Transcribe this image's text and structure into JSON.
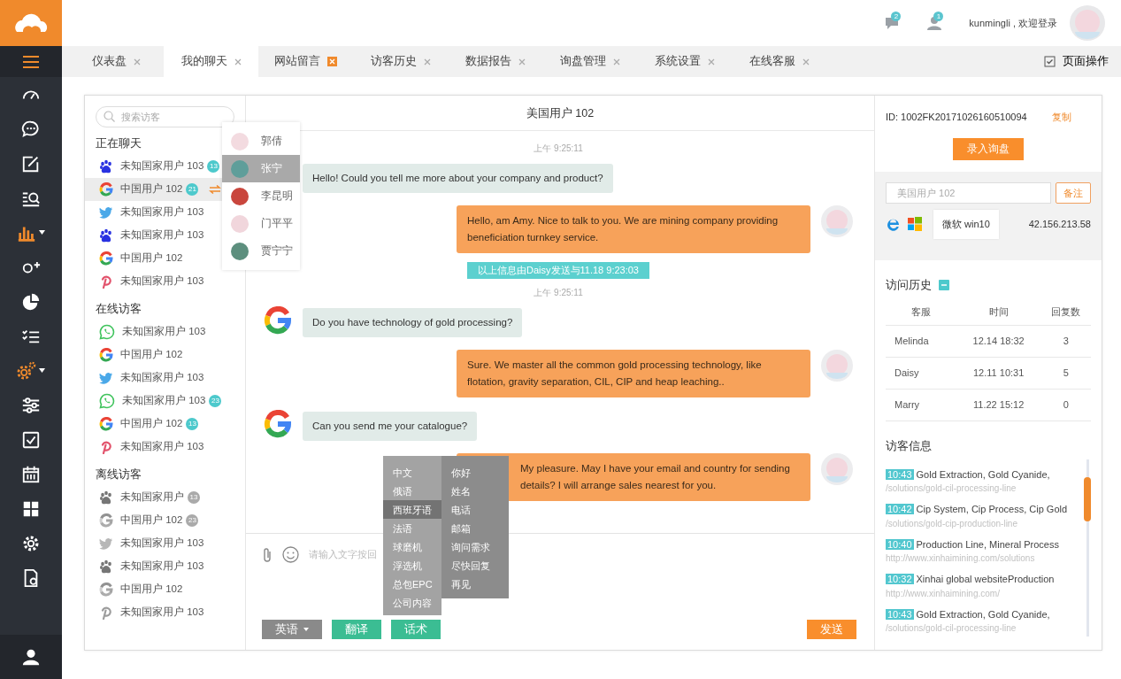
{
  "header": {
    "notifications": [
      {
        "count": "2"
      },
      {
        "count": "1"
      }
    ],
    "user_greeting": "kunmingli , 欢迎登录"
  },
  "sidebar": {
    "items": [
      {
        "expandable": false
      },
      {
        "expandable": false
      },
      {
        "expandable": false
      },
      {
        "expandable": false
      },
      {
        "expandable": true
      },
      {
        "expandable": false
      },
      {
        "expandable": false
      },
      {
        "expandable": false
      },
      {
        "expandable": true
      },
      {
        "expandable": false
      },
      {
        "expandable": false
      },
      {
        "expandable": false
      },
      {
        "expandable": false
      },
      {
        "expandable": false
      },
      {
        "expandable": false
      },
      {
        "expandable": false
      }
    ]
  },
  "tabs": [
    {
      "label": "仪表盘",
      "selected": false,
      "flagged": false
    },
    {
      "label": "我的聊天",
      "selected": true,
      "flagged": false
    },
    {
      "label": "网站留言",
      "selected": false,
      "flagged": true
    },
    {
      "label": "访客历史",
      "selected": false,
      "flagged": false
    },
    {
      "label": "数据报告",
      "selected": false,
      "flagged": false
    },
    {
      "label": "询盘管理",
      "selected": false,
      "flagged": false
    },
    {
      "label": "系统设置",
      "selected": false,
      "flagged": false
    },
    {
      "label": "在线客服",
      "selected": false,
      "flagged": false
    }
  ],
  "page_actions": "页面操作",
  "visitors": {
    "search": {
      "placeholder": "搜索访客"
    },
    "sections": [
      {
        "title": "正在聊天",
        "offline": false,
        "items": [
          {
            "kind": "baidu",
            "name": "未知国家用户 103",
            "count": "13",
            "selected": false,
            "transfer": false
          },
          {
            "kind": "google",
            "name": "中国用户 102",
            "count": "21",
            "selected": true,
            "transfer": true
          },
          {
            "kind": "twitter",
            "name": "未知国家用户 103",
            "selected": false,
            "transfer": false
          },
          {
            "kind": "baidu",
            "name": "未知国家用户 103",
            "selected": false,
            "transfer": false
          },
          {
            "kind": "google",
            "name": "中国用户 102",
            "selected": false,
            "transfer": false
          },
          {
            "kind": "pinterest",
            "name": "未知国家用户 103",
            "selected": false,
            "transfer": false
          }
        ]
      },
      {
        "title": "在线访客",
        "offline": false,
        "items": [
          {
            "kind": "whatsapp",
            "name": "未知国家用户 103",
            "selected": false,
            "transfer": false
          },
          {
            "kind": "google",
            "name": "中国用户 102",
            "selected": false,
            "transfer": false
          },
          {
            "kind": "twitter",
            "name": "未知国家用户 103",
            "selected": false,
            "transfer": false
          },
          {
            "kind": "whatsapp",
            "name": "未知国家用户 103",
            "count": "23",
            "selected": false,
            "transfer": false
          },
          {
            "kind": "google",
            "name": "中国用户 102",
            "count": "13",
            "selected": false,
            "transfer": false
          },
          {
            "kind": "pinterest",
            "name": "未知国家用户 103",
            "selected": false,
            "transfer": false
          }
        ]
      },
      {
        "title": "离线访客",
        "offline": true,
        "items": [
          {
            "kind": "baidu",
            "name": "未知国家用户",
            "count": "13",
            "selected": false,
            "transfer": false
          },
          {
            "kind": "google",
            "name": "中国用户 102",
            "count": "23",
            "selected": false,
            "transfer": false
          },
          {
            "kind": "twitter",
            "name": "未知国家用户 103",
            "selected": false,
            "transfer": false
          },
          {
            "kind": "baidu",
            "name": "未知国家用户 103",
            "selected": false,
            "transfer": false
          },
          {
            "kind": "google",
            "name": "中国用户 102",
            "selected": false,
            "transfer": false
          },
          {
            "kind": "pinterest",
            "name": "未知国家用户 103",
            "selected": false,
            "transfer": false
          }
        ]
      }
    ]
  },
  "transfer_menu": {
    "agents": [
      {
        "name": "郭倩",
        "color": "#f3dbe0",
        "selected": false
      },
      {
        "name": "张宁",
        "color": "#5f9e9a",
        "selected": true
      },
      {
        "name": "李昆明",
        "color": "#c9463d",
        "selected": false
      },
      {
        "name": "门平平",
        "color": "#f1d6dc",
        "selected": false
      },
      {
        "name": "贾宁宁",
        "color": "#5d8f7e",
        "selected": false
      }
    ]
  },
  "chat": {
    "title": "美国用户 102",
    "messages": [
      {
        "kind": "time",
        "text": "上午 9:25:11"
      },
      {
        "kind": "visitor",
        "text": "Hello! Could you tell me more about your company and product?"
      },
      {
        "kind": "agent",
        "text": "Hello, am Amy. Nice to talk to you. We are mining company providing beneficiation turnkey service."
      },
      {
        "kind": "notice",
        "text": "以上信息由Daisy发送与11.18  9:23:03"
      },
      {
        "kind": "time",
        "text": "上午 9:25:11"
      },
      {
        "kind": "visitor",
        "text": "Do you have technology of gold processing?"
      },
      {
        "kind": "agent",
        "text": "Sure. We master all the common gold processing technology, like flotation, gravity separation, CIL, CIP and heap leaching.."
      },
      {
        "kind": "visitor",
        "text": "Can you send me your catalogue?"
      },
      {
        "kind": "agent",
        "text": "My pleasure. May I have your email and country for sending details? I will arrange sales nearest for you."
      }
    ],
    "input": {
      "placeholder": "请输入文字按回"
    },
    "language": "英语",
    "translate_button": "翻译",
    "phrases_button": "话术",
    "send_button": "发送"
  },
  "phrase_menu": {
    "categories": [
      {
        "label": "中文",
        "selected": false
      },
      {
        "label": "俄语",
        "selected": false
      },
      {
        "label": "西班牙语",
        "selected": true
      },
      {
        "label": "法语",
        "selected": false
      },
      {
        "label": "球磨机",
        "selected": false
      },
      {
        "label": "浮选机",
        "selected": false
      },
      {
        "label": "总包EPC",
        "selected": false
      },
      {
        "label": "公司内容",
        "selected": false
      }
    ],
    "phrases": [
      "你好",
      "姓名",
      "电话",
      "邮箱",
      "询问需求",
      "尽快回复",
      "再见"
    ]
  },
  "visitor_info": {
    "id": "ID: 1002FK20171026160510094",
    "copy_link": "复制",
    "inquiry_button": "录入询盘",
    "note": {
      "placeholder": "美国用户 102",
      "button": "备注"
    },
    "os_tooltip": "微软 win10",
    "ip": "42.156.213.58",
    "history": {
      "title": "访问历史",
      "columns": [
        "客服",
        "时间",
        "回复数"
      ],
      "rows": [
        [
          "Melinda",
          "12.14 18:32",
          "3"
        ],
        [
          "Daisy",
          "12.11 10:31",
          "5"
        ],
        [
          "Marry",
          "11.22 15:12",
          "0"
        ]
      ]
    },
    "pages": {
      "title": "访客信息",
      "items": [
        {
          "time": "10:43",
          "title": "Gold Extraction, Gold Cyanide,",
          "url": "/solutions/gold-cil-processing-line"
        },
        {
          "time": "10:42",
          "title": "Cip System, Cip Process, Cip Gold",
          "url": "/solutions/gold-cip-production-line"
        },
        {
          "time": "10:40",
          "title": "Production Line, Mineral Process",
          "url": "http://www.xinhaimining.com/solutions"
        },
        {
          "time": "10:32",
          "title": "Xinhai global websiteProduction",
          "url": "http://www.xinhaimining.com/"
        },
        {
          "time": "10:43",
          "title": "Gold Extraction, Gold Cyanide,",
          "url": "/solutions/gold-cil-processing-line"
        }
      ]
    }
  }
}
